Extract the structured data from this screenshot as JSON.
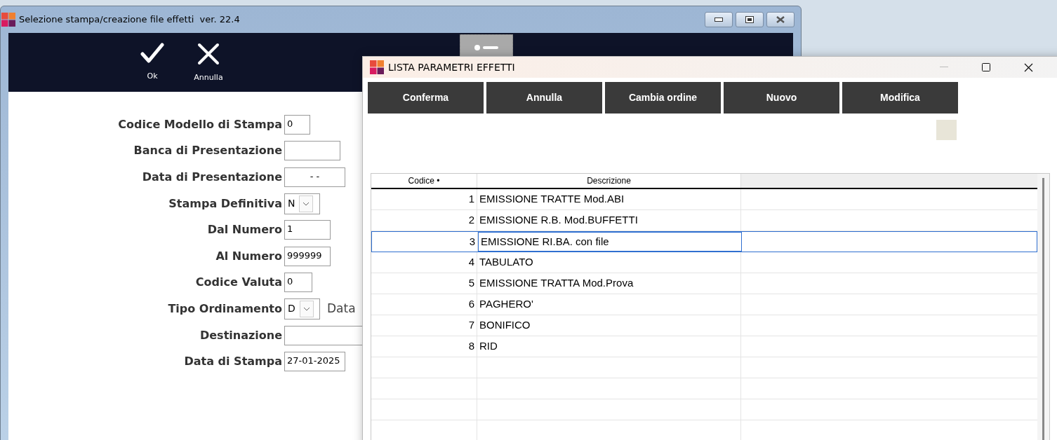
{
  "back_window": {
    "title": "Selezione stampa/creazione file effetti  ver. 22.4",
    "toolbar": [
      {
        "kind": "ok",
        "label": "Ok"
      },
      {
        "kind": "cancel",
        "label": "Annulla"
      }
    ],
    "form": [
      {
        "label": "Codice Modello di Stampa",
        "kind": "text",
        "value": "0"
      },
      {
        "label": "Banca di Presentazione",
        "kind": "text"
      },
      {
        "label": "Data di Presentazione",
        "kind": "date",
        "value": "- -"
      },
      {
        "label": "Stampa Definitiva",
        "kind": "select",
        "value": "N"
      },
      {
        "label": "Dal Numero",
        "kind": "text",
        "value": "1"
      },
      {
        "label": "Al Numero",
        "kind": "text",
        "value": "999999"
      },
      {
        "label": "Codice Valuta",
        "kind": "text",
        "value": "0"
      },
      {
        "label": "Tipo Ordinamento",
        "kind": "select",
        "value": "D",
        "note": "Data"
      },
      {
        "label": "Destinazione",
        "kind": "text"
      },
      {
        "label": "Data di Stampa",
        "kind": "text",
        "value": "27-01-2025"
      }
    ]
  },
  "front_window": {
    "title": "LISTA PARAMETRI EFFETTI",
    "buttons": [
      "Conferma",
      "Annulla",
      "Cambia ordine",
      "Nuovo",
      "Modifica"
    ],
    "table": {
      "columns": [
        "Codice •",
        "Descrizione"
      ],
      "rows": [
        {
          "codice": "1",
          "descrizione": "EMISSIONE TRATTE Mod.ABI",
          "selected": false
        },
        {
          "codice": "2",
          "descrizione": "EMISSIONE R.B. Mod.BUFFETTI",
          "selected": false
        },
        {
          "codice": "3",
          "descrizione": "EMISSIONE RI.BA. con file",
          "selected": true
        },
        {
          "codice": "4",
          "descrizione": "TABULATO",
          "selected": false
        },
        {
          "codice": "5",
          "descrizione": "EMISSIONE TRATTA Mod.Prova",
          "selected": false
        },
        {
          "codice": "6",
          "descrizione": "PAGHERO'",
          "selected": false
        },
        {
          "codice": "7",
          "descrizione": "BONIFICO",
          "selected": false
        },
        {
          "codice": "8",
          "descrizione": "RID",
          "selected": false
        }
      ]
    }
  }
}
